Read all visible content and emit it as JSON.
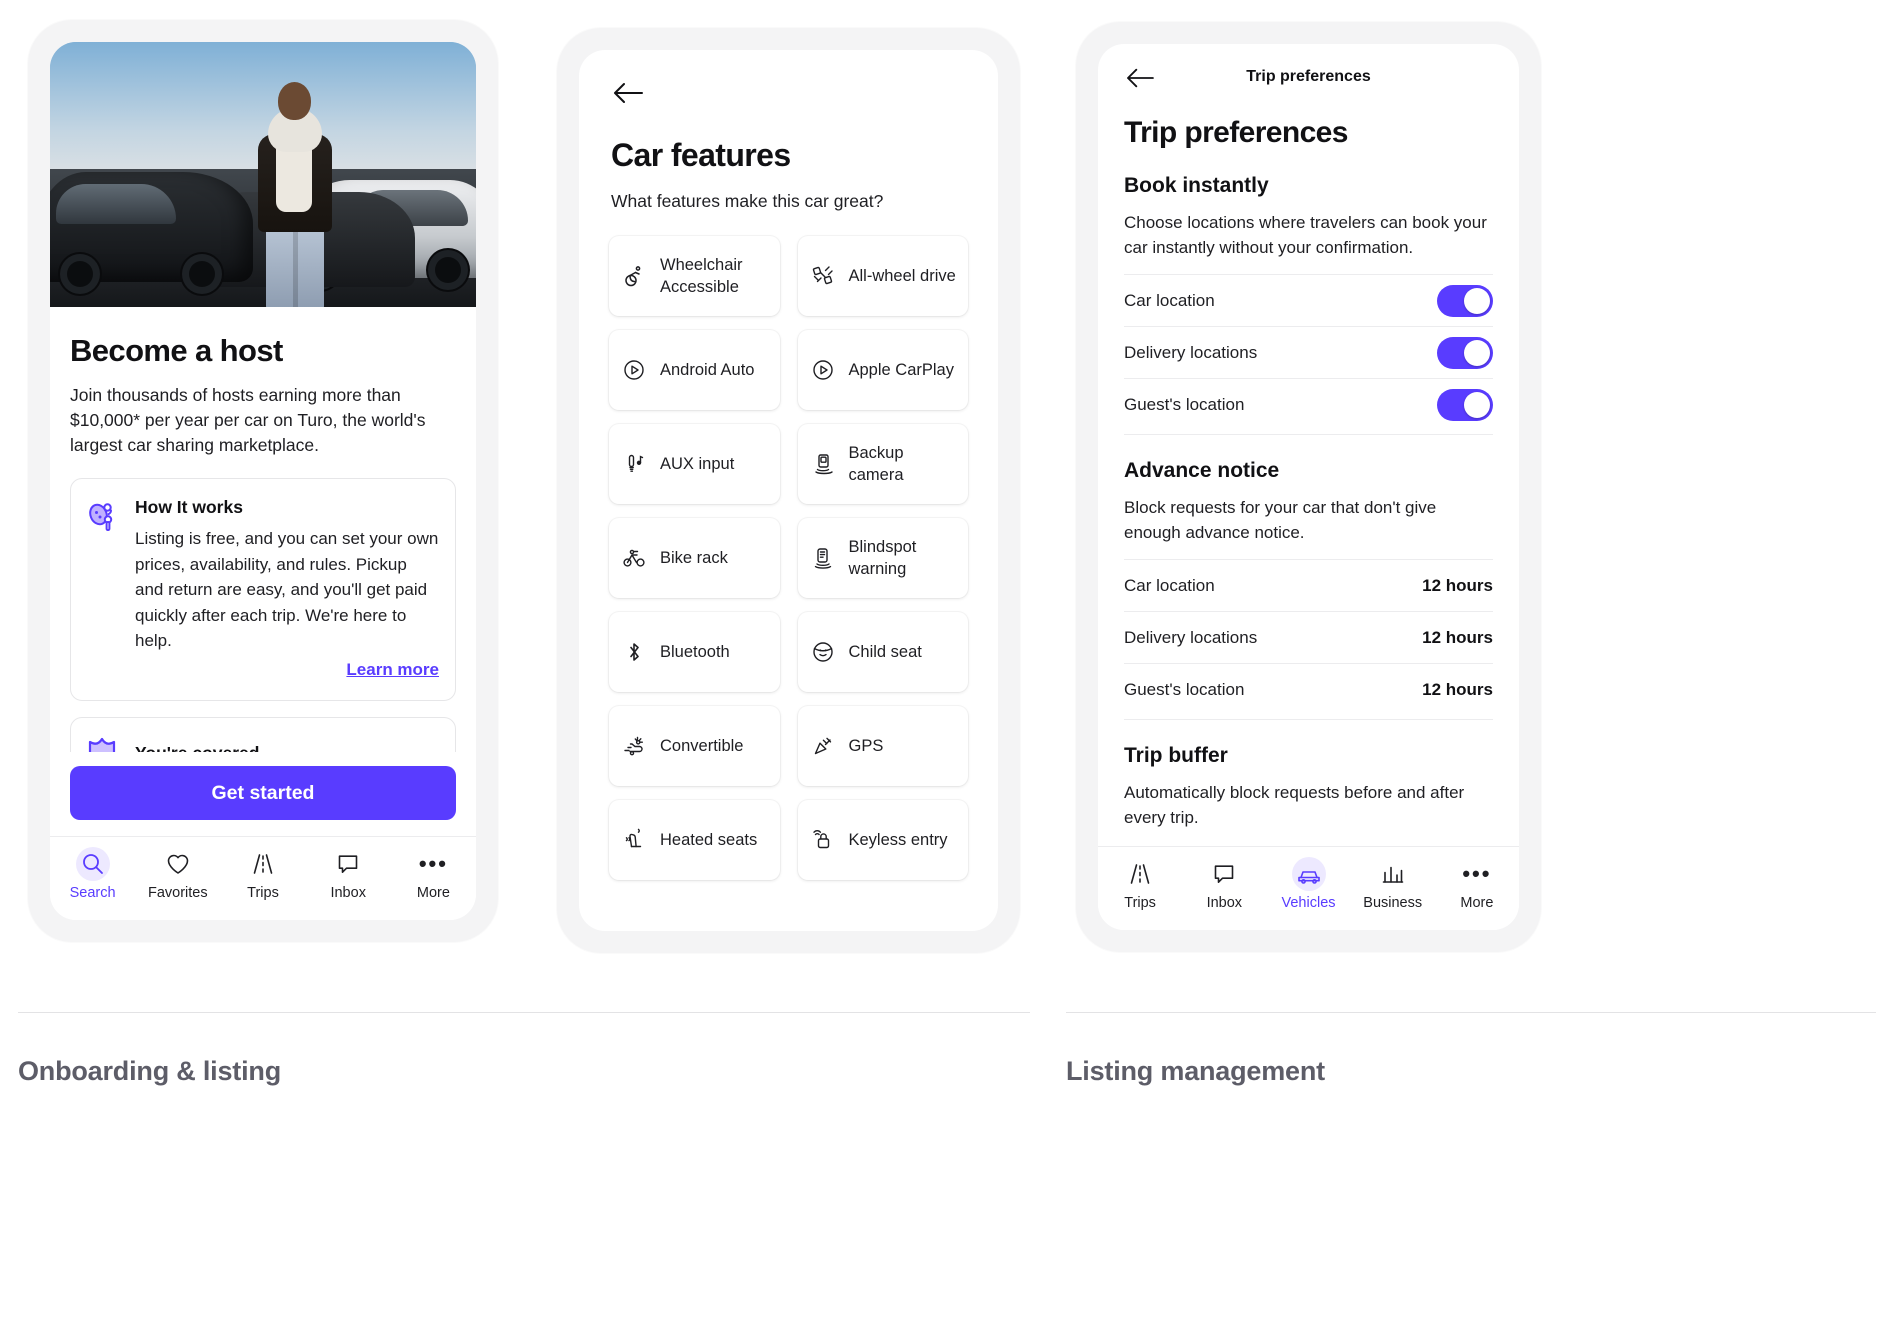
{
  "captions": {
    "left": "Onboarding & listing",
    "right": "Listing management"
  },
  "phone1": {
    "hero_alt": "host standing in front of cars",
    "title": "Become a host",
    "subtitle": "Join thousands of hosts earning more than $10,000* per year per car on Turo, the world's largest car sharing marketplace.",
    "cards": [
      {
        "icon": "key-fob-icon",
        "title": "How It works",
        "text": "Listing is free, and you can set your own prices, availability, and rules. Pickup and return are easy, and you'll get paid quickly after each trip. We're here to help.",
        "link": "Learn more"
      },
      {
        "icon": "shield-icon",
        "title": "You're covered"
      }
    ],
    "cta": "Get started",
    "tabs": [
      {
        "label": "Search",
        "icon": "search-icon",
        "active": true
      },
      {
        "label": "Favorites",
        "icon": "heart-icon",
        "active": false
      },
      {
        "label": "Trips",
        "icon": "road-icon",
        "active": false
      },
      {
        "label": "Inbox",
        "icon": "chat-bubble-icon",
        "active": false
      },
      {
        "label": "More",
        "icon": "ellipsis-icon",
        "active": false
      }
    ]
  },
  "phone2": {
    "back_icon": "back-arrow-icon",
    "title": "Car features",
    "subtitle": "What features make this car great?",
    "features": [
      {
        "label": "Wheelchair Accessible",
        "icon": "wheelchair-icon"
      },
      {
        "label": "All-wheel drive",
        "icon": "all-wheel-drive-icon"
      },
      {
        "label": "Android Auto",
        "icon": "android-auto-icon"
      },
      {
        "label": "Apple CarPlay",
        "icon": "apple-carplay-icon"
      },
      {
        "label": "AUX input",
        "icon": "aux-input-icon"
      },
      {
        "label": "Backup camera",
        "icon": "backup-camera-icon"
      },
      {
        "label": "Bike rack",
        "icon": "bike-rack-icon"
      },
      {
        "label": "Blindspot warning",
        "icon": "blindspot-warning-icon"
      },
      {
        "label": "Bluetooth",
        "icon": "bluetooth-icon"
      },
      {
        "label": "Child seat",
        "icon": "child-seat-icon"
      },
      {
        "label": "Convertible",
        "icon": "convertible-icon"
      },
      {
        "label": "GPS",
        "icon": "gps-icon"
      },
      {
        "label": "Heated seats",
        "icon": "heated-seats-icon"
      },
      {
        "label": "Keyless entry",
        "icon": "keyless-entry-icon"
      }
    ]
  },
  "phone3": {
    "back_icon": "back-arrow-icon",
    "nav_title": "Trip preferences",
    "title": "Trip preferences",
    "sections": [
      {
        "heading": "Book instantly",
        "description": "Choose locations where travelers can book your car instantly without your confirmation.",
        "rows": [
          {
            "label": "Car location",
            "toggle": true
          },
          {
            "label": "Delivery locations",
            "toggle": true
          },
          {
            "label": "Guest's location",
            "toggle": true
          }
        ]
      },
      {
        "heading": "Advance notice",
        "description": "Block requests for your car that don't give enough advance notice.",
        "rows": [
          {
            "label": "Car location",
            "value": "12 hours"
          },
          {
            "label": "Delivery locations",
            "value": "12 hours"
          },
          {
            "label": "Guest's location",
            "value": "12 hours"
          }
        ]
      },
      {
        "heading": "Trip buffer",
        "description": "Automatically block requests before and after every trip.",
        "rows": []
      }
    ],
    "tabs": [
      {
        "label": "Trips",
        "icon": "road-icon",
        "active": false
      },
      {
        "label": "Inbox",
        "icon": "chat-bubble-icon",
        "active": false
      },
      {
        "label": "Vehicles",
        "icon": "car-icon",
        "active": true
      },
      {
        "label": "Business",
        "icon": "bar-chart-icon",
        "active": false
      },
      {
        "label": "More",
        "icon": "ellipsis-icon",
        "active": false
      }
    ]
  },
  "colors": {
    "accent": "#593cff",
    "text": "#1f1f23",
    "muted": "#5d5d68",
    "card_bg": "#ffffff",
    "frame_bg": "#f4f4f5"
  }
}
